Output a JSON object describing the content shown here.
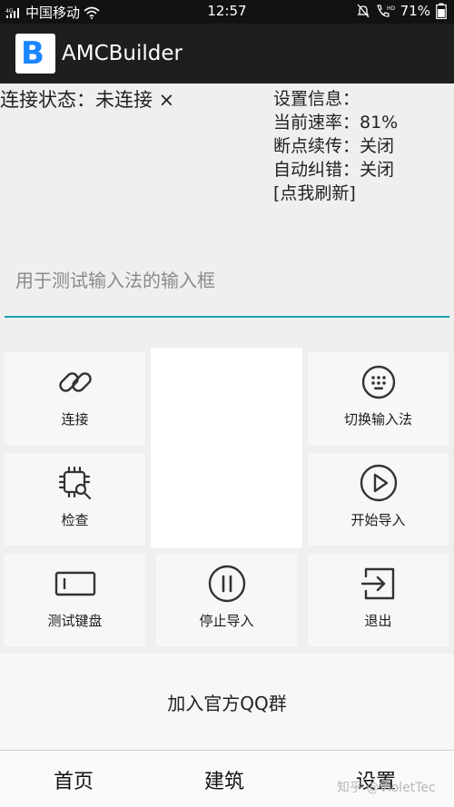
{
  "status_bar": {
    "signal": "4G",
    "carrier": "中国移动",
    "time": "12:57",
    "hd": "HD",
    "battery": "71%",
    "icons": [
      "signal-icon",
      "wifi-icon",
      "mute-icon",
      "call-hd-icon",
      "battery-icon"
    ]
  },
  "app_bar": {
    "logo_letter": "B",
    "title": "AMCBuilder"
  },
  "connection": {
    "text": "连接状态：未连接 ×"
  },
  "settings": {
    "header": "设置信息：",
    "rate": "当前速率：81%",
    "resume": "断点续传：关闭",
    "autocorrect": "自动纠错：关闭",
    "refresh": "[点我刷新]"
  },
  "ime_input": {
    "placeholder": "用于测试输入法的输入框",
    "value": ""
  },
  "tiles": {
    "connect": "连接",
    "switch_ime": "切换输入法",
    "check": "检查",
    "start_import": "开始导入",
    "test_keyboard": "测试键盘",
    "stop_import": "停止导入",
    "exit": "退出"
  },
  "qq_button": "加入官方QQ群",
  "bottom_nav": {
    "home": "首页",
    "building": "建筑",
    "settings": "设置"
  },
  "watermark": "知乎 @VioletTec",
  "colors": {
    "accent": "#1aa0b8",
    "logo_blue": "#1a86ff",
    "app_bar": "#1e1e1e",
    "status_bar": "#121212"
  }
}
